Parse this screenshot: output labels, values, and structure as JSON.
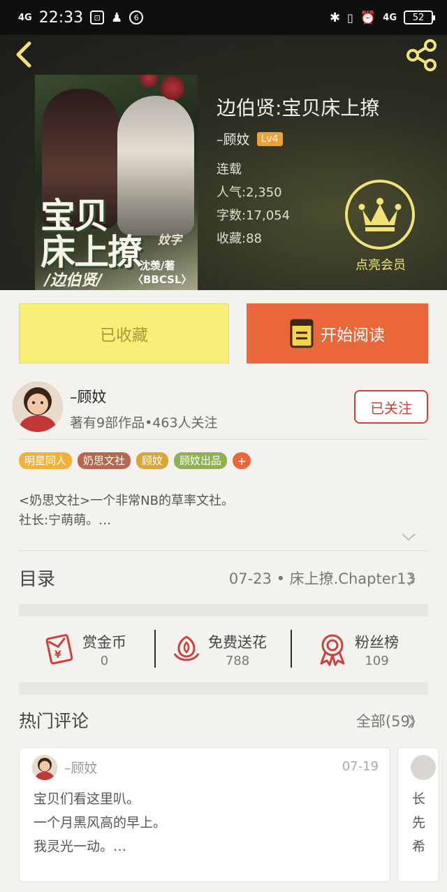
{
  "status_bar": {
    "network": "4G",
    "time": "22:33",
    "right_network": "4G",
    "battery": "52"
  },
  "book": {
    "title": "边伯贤:宝贝床上撩",
    "author": "–顾妏",
    "level": "Lv4",
    "status": "连载",
    "popularity_label": "人气:",
    "popularity": "2,350",
    "words_label": "字数:",
    "words": "17,054",
    "favorites_label": "收藏:",
    "favorites": "88",
    "cover": {
      "title_line1": "宝贝",
      "title_line2": "床上撩",
      "subtitle": "/边伯贤/",
      "credit": "沈羡/著",
      "tag": "〈BBCSL〉",
      "stamp": "妏字"
    }
  },
  "vip": {
    "label": "点亮会员"
  },
  "actions": {
    "favorited_label": "已收藏",
    "read_label": "开始阅读"
  },
  "author_card": {
    "name": "–顾妏",
    "stats": "著有9部作品•463人关注",
    "follow_label": "已关注"
  },
  "tags": [
    {
      "label": "明星同人",
      "color": "#f2b138"
    },
    {
      "label": "奶思文社",
      "color": "#b5684e"
    },
    {
      "label": "顾妏",
      "color": "#d9a639"
    },
    {
      "label": "顾妏出品",
      "color": "#8fb153"
    }
  ],
  "tag_add_label": "+",
  "description": {
    "line1": "<奶思文社>一个非常NB的草率文社。",
    "line2": "社长:宁萌萌。…"
  },
  "toc": {
    "label": "目录",
    "latest": "07-23 • 床上撩.Chapter13"
  },
  "stats": [
    {
      "label": "赏金币",
      "value": "0"
    },
    {
      "label": "免费送花",
      "value": "788"
    },
    {
      "label": "粉丝榜",
      "value": "109"
    }
  ],
  "comments": {
    "title": "热门评论",
    "all_label": "全部(59)",
    "items": [
      {
        "user": "–顾妏",
        "date": "07-19",
        "lines": [
          "宝贝们看这里叭。",
          "一个月黑风高的早上。",
          "我灵光一动。…"
        ]
      },
      {
        "user": "",
        "date": "",
        "lines": [
          "长",
          "先",
          "希"
        ]
      }
    ]
  },
  "colors": {
    "accent_orange": "#e9673b",
    "fav_yellow": "#f8ef78",
    "follow_red": "#c9413c",
    "vip_gold": "#f2e27a"
  }
}
